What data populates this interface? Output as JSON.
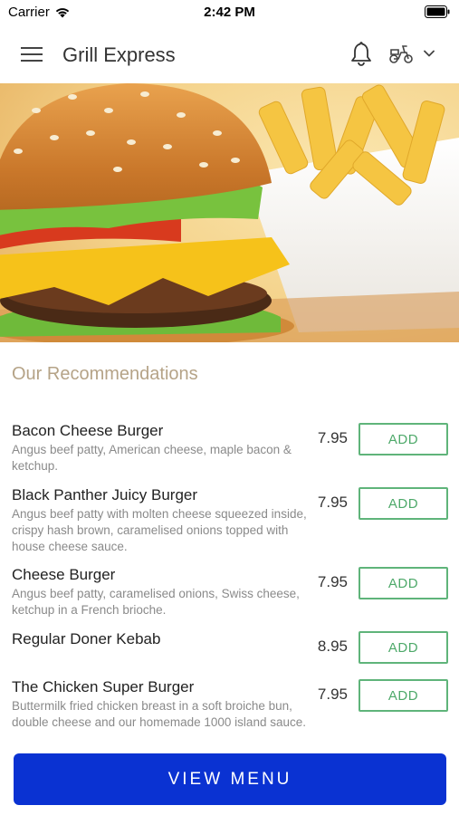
{
  "status_bar": {
    "carrier": "Carrier",
    "time": "2:42 PM"
  },
  "header": {
    "title": "Grill Express"
  },
  "section": {
    "title": "Our Recommendations"
  },
  "items": [
    {
      "name": "Bacon Cheese Burger",
      "description": "Angus beef patty, American cheese, maple bacon & ketchup.",
      "price": "7.95",
      "add_label": "ADD"
    },
    {
      "name": "Black Panther Juicy Burger",
      "description": "Angus beef patty with molten cheese squeezed inside, crispy hash brown, caramelised onions topped with house cheese sauce.",
      "price": "7.95",
      "add_label": "ADD"
    },
    {
      "name": "Cheese Burger",
      "description": "Angus beef patty, caramelised onions, Swiss cheese, ketchup in a French brioche.",
      "price": "7.95",
      "add_label": "ADD"
    },
    {
      "name": "Regular Doner Kebab",
      "description": "",
      "price": "8.95",
      "add_label": "ADD"
    },
    {
      "name": "The Chicken Super Burger",
      "description": "Buttermilk fried chicken breast in a soft broiche bun, double cheese and our homemade 1000 island sauce.",
      "price": "7.95",
      "add_label": "ADD"
    }
  ],
  "footer": {
    "view_menu_label": "VIEW MENU"
  },
  "colors": {
    "accent": "#0a32d2",
    "add_green": "#5fb47a",
    "section_title": "#b5a387"
  },
  "icons": {
    "menu": "hamburger-icon",
    "notifications": "bell-icon",
    "delivery": "scooter-icon",
    "dropdown": "chevron-down-icon"
  }
}
